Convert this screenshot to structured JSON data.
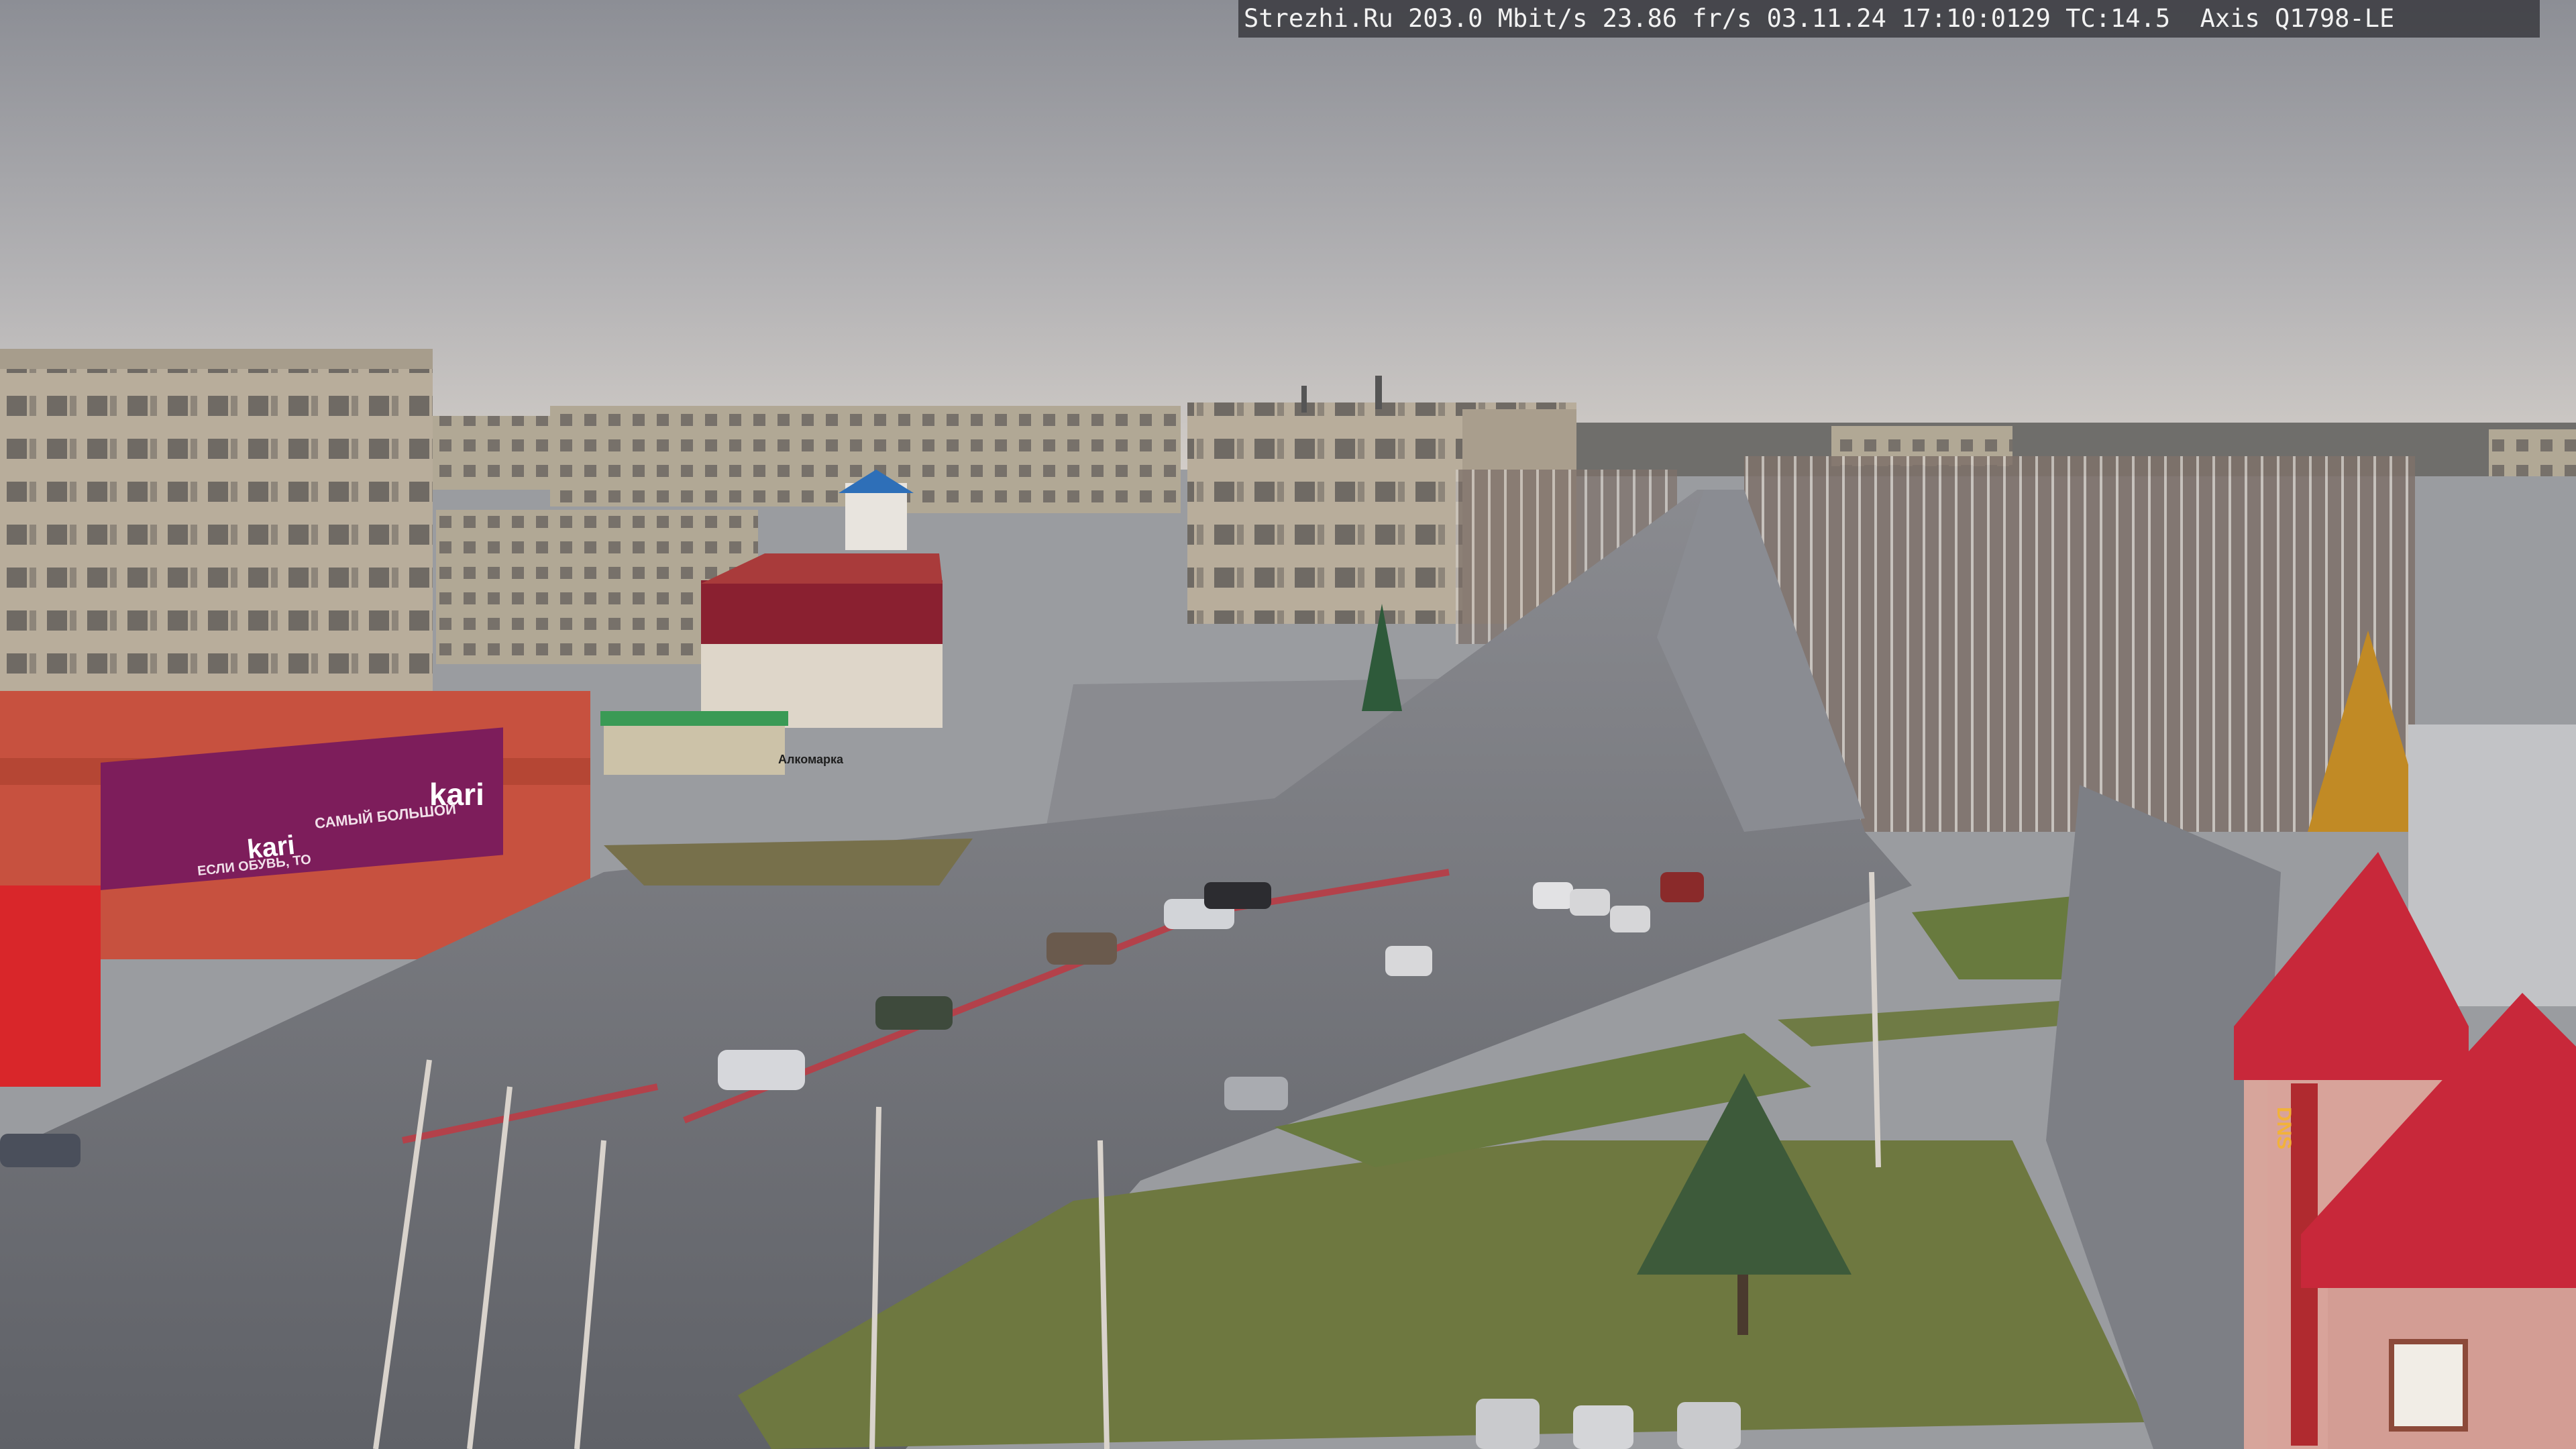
{
  "overlay": {
    "text": "Strezhi.Ru 203.0 Mbit/s 23.86 fr/s 03.11.24 17:10:0129 TC:14.5  Axis Q1798-LE"
  },
  "signs": {
    "store_brand": "kari",
    "store_brand_2": "kari",
    "store_slogan_1": "САМЫЙ БОЛЬШОЙ",
    "store_slogan_2": "ЕСЛИ ОБУВЬ, ТО",
    "small_store_sign": "Алкомарка",
    "dns_vertical": "DNS"
  },
  "colors": {
    "sky_top": "#8e9097",
    "sky_bottom": "#c9c7c6",
    "asphalt": "#6e7076",
    "panel_building": "#b7ab98",
    "store_red": "#c7513f",
    "kari_purple": "#7d1d5b",
    "tower_red": "#c8283a",
    "grass": "#6e7840"
  }
}
